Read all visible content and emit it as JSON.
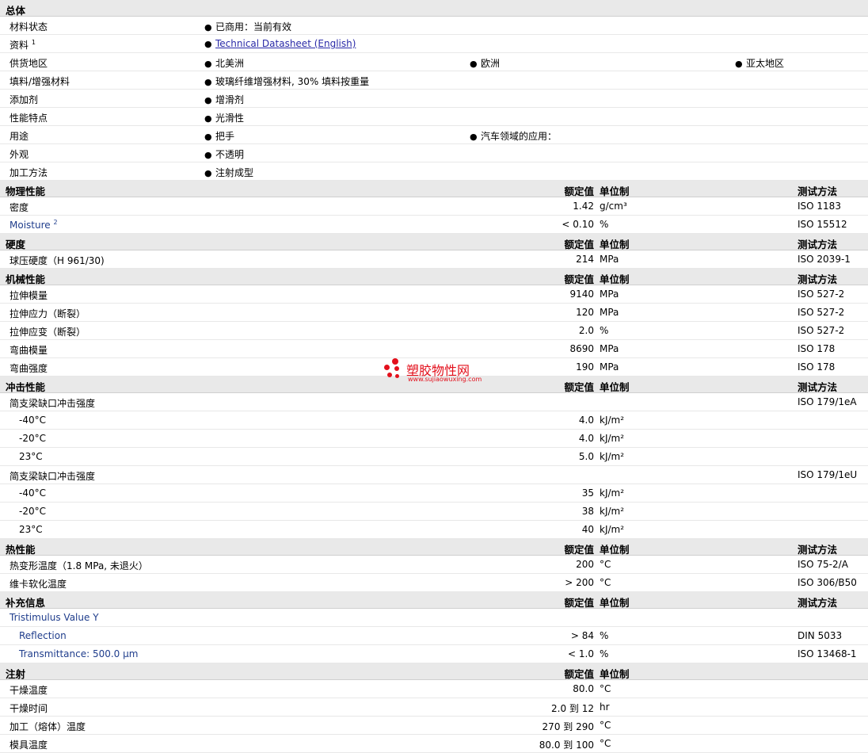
{
  "overview": {
    "title": "总体",
    "rows": [
      {
        "label": "材料状态",
        "items": [
          "已商用：当前有效"
        ]
      },
      {
        "label": "资料",
        "sup": "1",
        "items": [
          "Technical Datasheet (English)"
        ],
        "link": true
      },
      {
        "label": "供货地区",
        "items": [
          "北美洲",
          "欧洲",
          "亚太地区"
        ]
      },
      {
        "label": "填料/增强材料",
        "items": [
          "玻璃纤维增强材料, 30% 填料按重量"
        ]
      },
      {
        "label": "添加剂",
        "items": [
          "增滑剂"
        ]
      },
      {
        "label": "性能特点",
        "items": [
          "光滑性"
        ]
      },
      {
        "label": "用途",
        "items": [
          "把手",
          "汽车领域的应用："
        ]
      },
      {
        "label": "外观",
        "items": [
          "不透明"
        ]
      },
      {
        "label": "加工方法",
        "items": [
          "注射成型"
        ]
      }
    ]
  },
  "headers": {
    "nominal": "额定值",
    "unit": "单位制",
    "method": "测试方法"
  },
  "sections": [
    {
      "title": "物理性能",
      "method_header": true,
      "rows": [
        {
          "label": "密度",
          "value": "1.42",
          "unit": "g/cm³",
          "method": "ISO 1183"
        },
        {
          "label": "Moisture",
          "sup": "2",
          "blue": true,
          "value": "< 0.10",
          "unit": "%",
          "method": "ISO 15512"
        }
      ]
    },
    {
      "title": "硬度",
      "method_header": true,
      "rows": [
        {
          "label": "球压硬度（H 961/30)",
          "value": "214",
          "unit": "MPa",
          "method": "ISO 2039-1"
        }
      ]
    },
    {
      "title": "机械性能",
      "method_header": true,
      "rows": [
        {
          "label": "拉伸模量",
          "value": "9140",
          "unit": "MPa",
          "method": "ISO 527-2"
        },
        {
          "label": "拉伸应力（断裂）",
          "value": "120",
          "unit": "MPa",
          "method": "ISO 527-2"
        },
        {
          "label": "拉伸应变（断裂）",
          "value": "2.0",
          "unit": "%",
          "method": "ISO 527-2"
        },
        {
          "label": "弯曲模量",
          "value": "8690",
          "unit": "MPa",
          "method": "ISO 178"
        },
        {
          "label": "弯曲强度",
          "value": "190",
          "unit": "MPa",
          "method": "ISO 178"
        }
      ]
    },
    {
      "title": "冲击性能",
      "method_header": true,
      "rows": [
        {
          "label": "简支梁缺口冲击强度",
          "value": "",
          "unit": "",
          "method": "ISO 179/1eA"
        },
        {
          "label": "-40°C",
          "sub": true,
          "value": "4.0",
          "unit": "kJ/m²",
          "method": ""
        },
        {
          "label": "-20°C",
          "sub": true,
          "value": "4.0",
          "unit": "kJ/m²",
          "method": ""
        },
        {
          "label": "23°C",
          "sub": true,
          "value": "5.0",
          "unit": "kJ/m²",
          "method": ""
        },
        {
          "label": "简支梁缺口冲击强度",
          "value": "",
          "unit": "",
          "method": "ISO 179/1eU"
        },
        {
          "label": "-40°C",
          "sub": true,
          "value": "35",
          "unit": "kJ/m²",
          "method": ""
        },
        {
          "label": "-20°C",
          "sub": true,
          "value": "38",
          "unit": "kJ/m²",
          "method": ""
        },
        {
          "label": "23°C",
          "sub": true,
          "value": "40",
          "unit": "kJ/m²",
          "method": ""
        }
      ]
    },
    {
      "title": "热性能",
      "method_header": true,
      "rows": [
        {
          "label": "热变形温度（1.8 MPa, 未退火）",
          "value": "200",
          "unit": "°C",
          "method": "ISO 75-2/A"
        },
        {
          "label": "维卡软化温度",
          "value": "> 200",
          "unit": "°C",
          "method": "ISO 306/B50"
        }
      ]
    },
    {
      "title": "补充信息",
      "method_header": true,
      "rows": [
        {
          "label": "Tristimulus Value Y",
          "blue": true,
          "value": "",
          "unit": "",
          "method": ""
        },
        {
          "label": "Reflection",
          "blue": true,
          "sub": true,
          "value": "> 84",
          "unit": "%",
          "method": "DIN 5033"
        },
        {
          "label": "Transmittance: 500.0 µm",
          "blue": true,
          "sub": true,
          "value": "< 1.0",
          "unit": "%",
          "method": "ISO 13468-1"
        }
      ]
    },
    {
      "title": "注射",
      "method_header": false,
      "rows": [
        {
          "label": "干燥温度",
          "value": "80.0",
          "unit": "°C",
          "method": ""
        },
        {
          "label": "干燥时间",
          "value": "2.0 到  12",
          "unit": "hr",
          "method": ""
        },
        {
          "label": "加工（熔体）温度",
          "value": "270 到  290",
          "unit": "°C",
          "method": ""
        },
        {
          "label": "模具温度",
          "value": "80.0 到  100",
          "unit": "°C",
          "method": ""
        }
      ]
    }
  ],
  "watermark": {
    "title": "塑胶物性网",
    "url": "www.sujiaowuxing.com",
    "color": "#e3101c"
  }
}
